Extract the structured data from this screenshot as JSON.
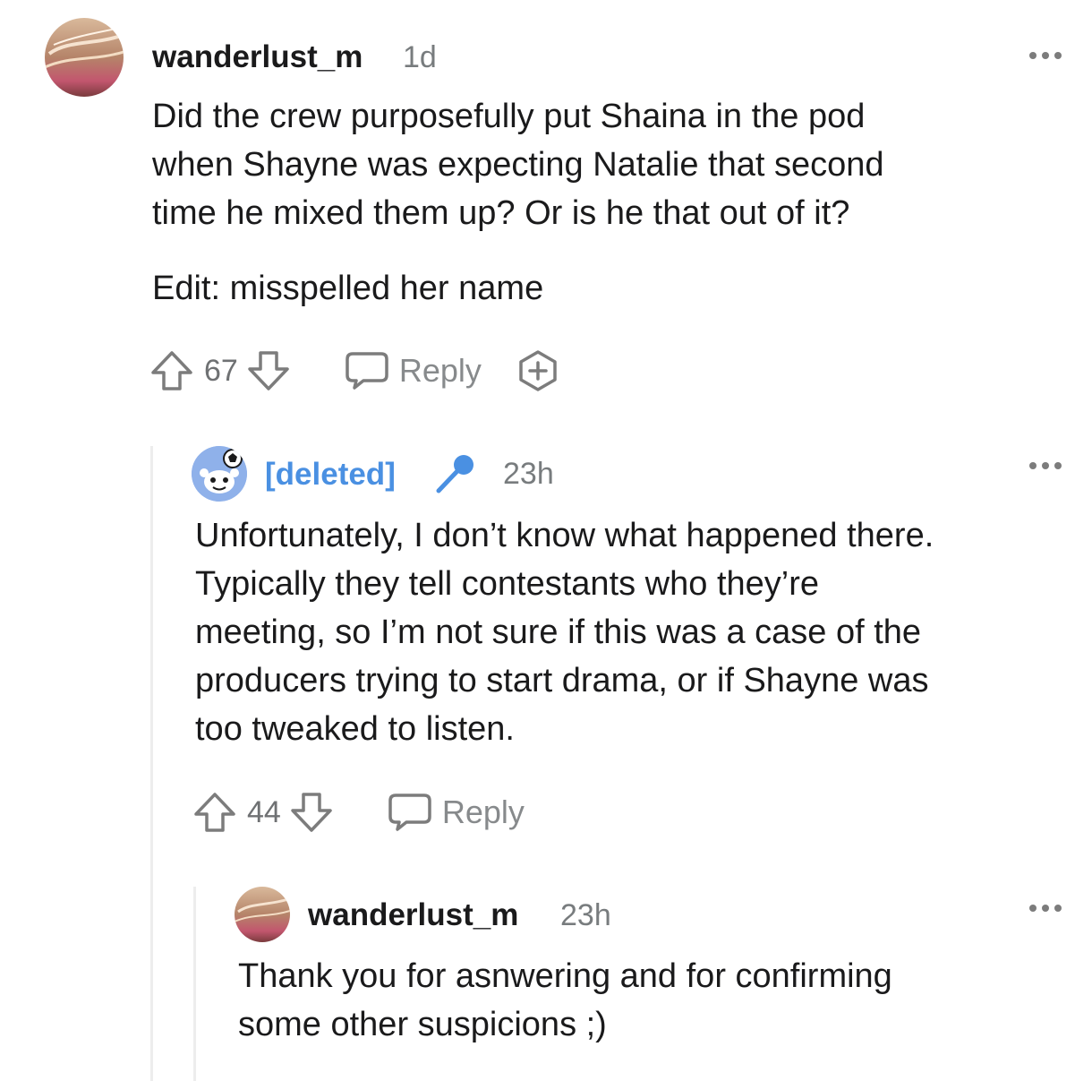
{
  "comments": [
    {
      "username": "wanderlust_m",
      "time": "1d",
      "body": [
        "Did the crew purposefully put Shaina in the pod",
        "when Shayne was expecting Natalie that second",
        "time he mixed them up? Or is he that out of it?"
      ],
      "edit": "Edit: misspelled her name",
      "votes": "67",
      "reply_label": "Reply"
    },
    {
      "username": "[deleted]",
      "time": "23h",
      "body": [
        "Unfortunately, I don’t know what happened there.",
        "Typically they tell contestants who they’re",
        "meeting, so I’m not sure if this was a case of the",
        "producers trying to start drama, or if Shayne was",
        "too tweaked to listen."
      ],
      "votes": "44",
      "reply_label": "Reply"
    },
    {
      "username": "wanderlust_m",
      "time": "23h",
      "body": [
        "Thank you for asnwering and for confirming",
        "some other suspicions ;)"
      ]
    }
  ],
  "icons": {
    "upvote": "upvote-icon",
    "downvote": "downvote-icon",
    "reply": "reply-bubble-icon",
    "award": "award-icon",
    "more": "more-options-icon",
    "microphone": "microphone-icon",
    "avatar_snoo": "snoo-avatar-icon"
  },
  "colors": {
    "deleted_username": "#4a90e2",
    "meta_gray": "#787c7e",
    "action_gray": "#878a8c",
    "thread_line": "#ededed"
  }
}
